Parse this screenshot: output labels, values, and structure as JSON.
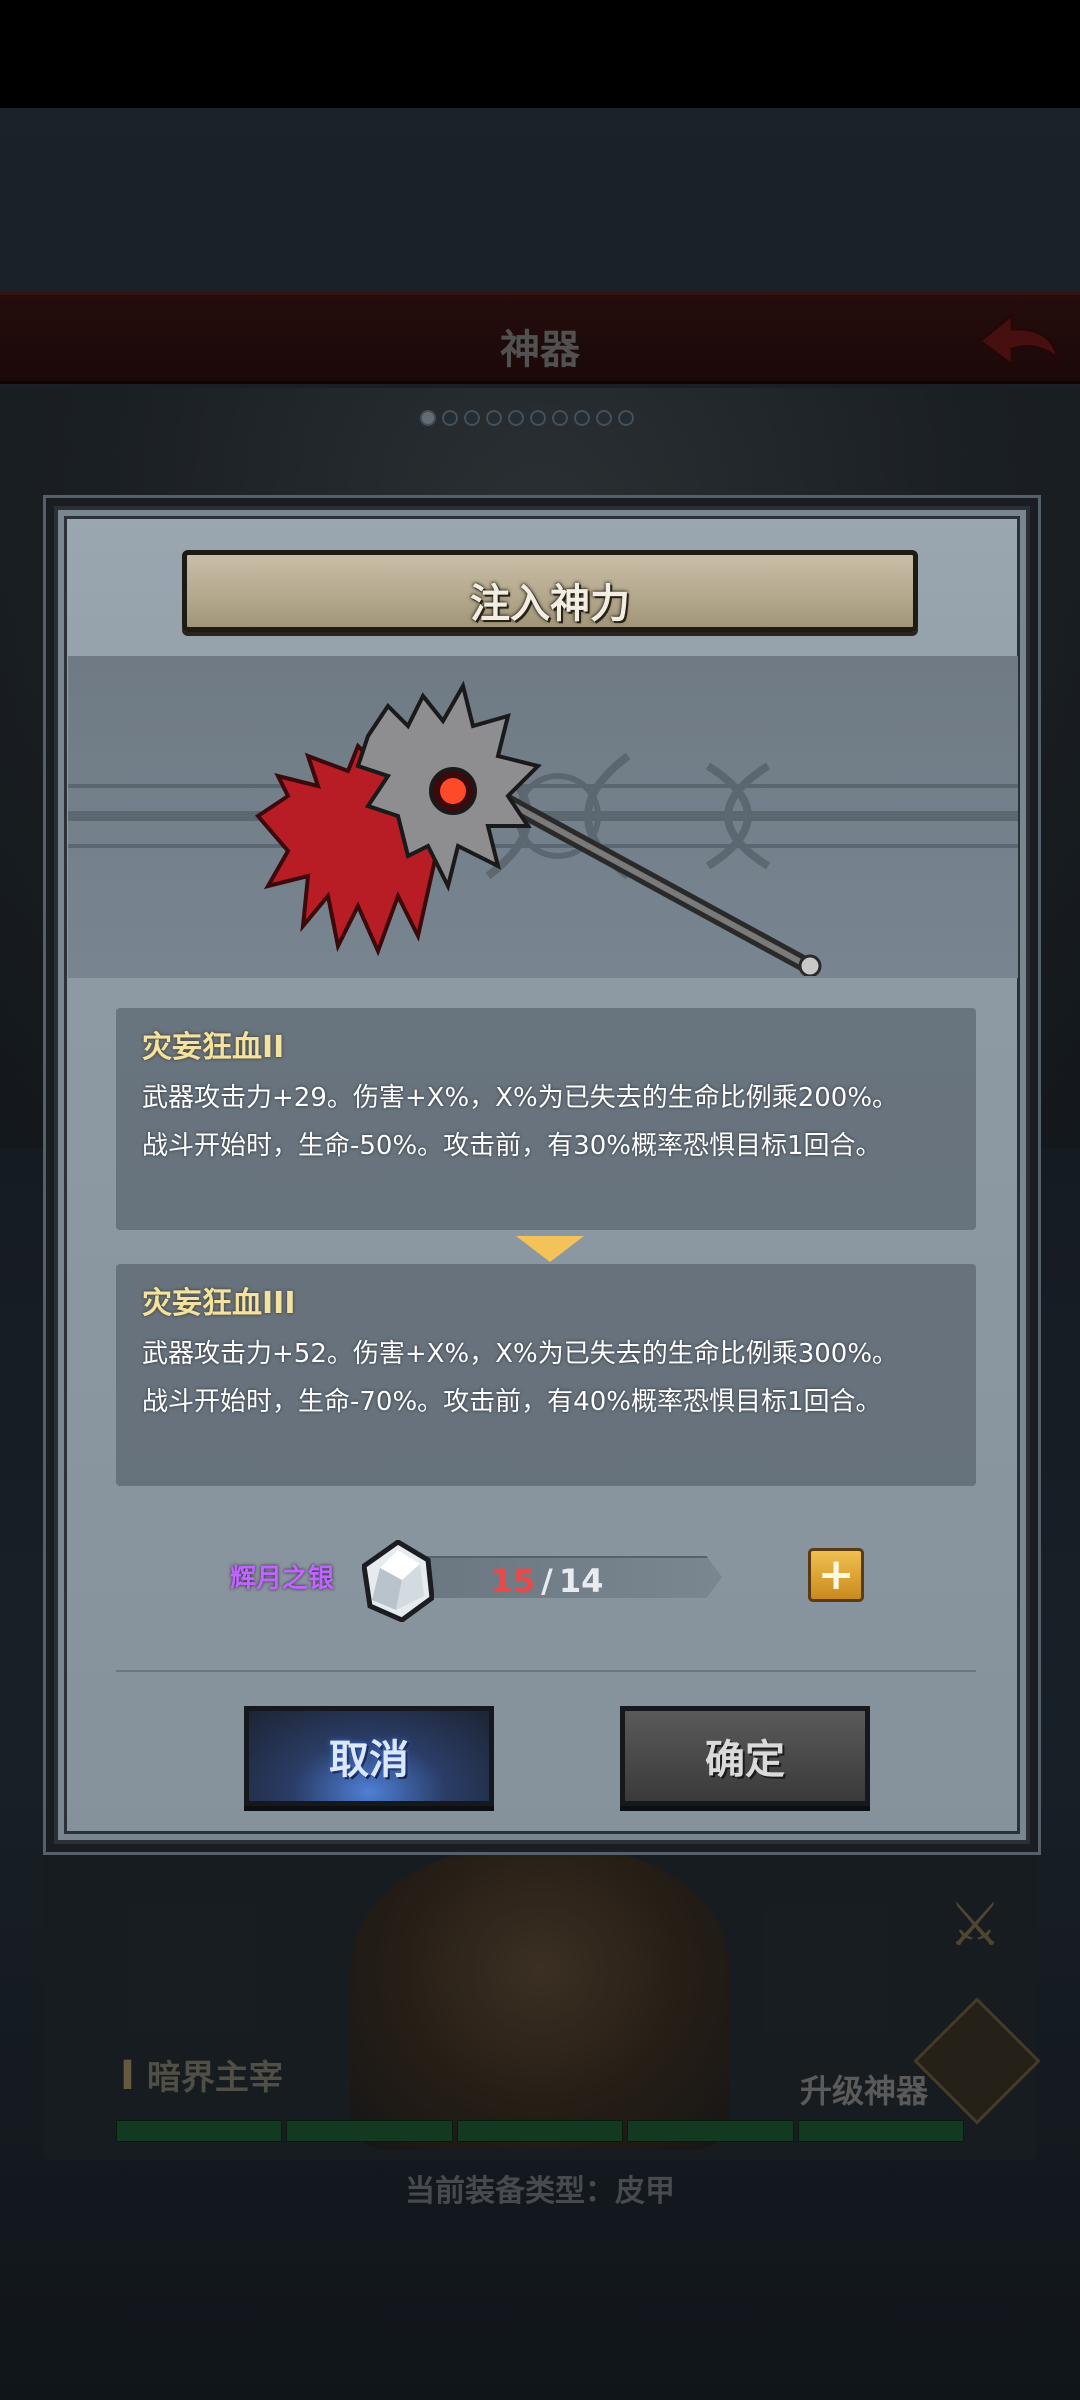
{
  "background": {
    "header_title": "神器",
    "page_dots_total": 10,
    "page_dots_active_index": 0,
    "character_level_glyph": "I",
    "character_name": "暗界主宰",
    "upgrade_label": "升级神器",
    "hp_segments": 5,
    "equip_type_label": "当前装备类型：",
    "equip_type_value": "皮甲"
  },
  "dialog": {
    "title": "注入神力",
    "current_skill": {
      "name": "灾妄狂血II",
      "desc": "武器攻击力+29。伤害+X%，X%为已失去的生命比例乘200%。\n战斗开始时，生命-50%。攻击前，有30%概率恐惧目标1回合。"
    },
    "next_skill": {
      "name": "灾妄狂血III",
      "desc": "武器攻击力+52。伤害+X%，X%为已失去的生命比例乘300%。\n战斗开始时，生命-70%。攻击前，有40%概率恐惧目标1回合。"
    },
    "material": {
      "name": "辉月之银",
      "owned": "15",
      "separator": "/",
      "required": "14"
    },
    "add_button_symbol": "+",
    "cancel_label": "取消",
    "confirm_label": "确定"
  },
  "colors": {
    "skill_name": "#f3e2a0",
    "material_name": "#c066ff",
    "owned_count": "#e84a4a",
    "cancel_glow": "#4f7fd6",
    "plus_button": "#f0c050"
  },
  "icons": {
    "back": "red-back-arrow-icon",
    "weapon": "blood-axe-icon",
    "material": "silver-crystal-icon",
    "add": "plus-icon",
    "transition": "chevron-down-icon",
    "upgrade": "upgrade-arrow-icon",
    "swords": "crossed-swords-icon"
  }
}
